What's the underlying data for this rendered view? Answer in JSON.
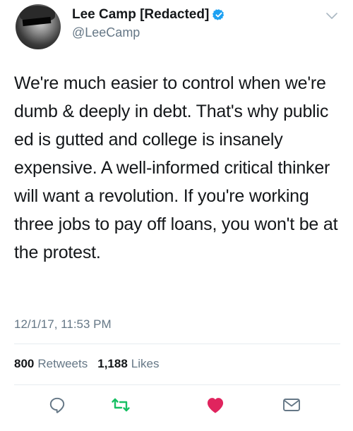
{
  "author": {
    "display_name": "Lee Camp [Redacted]",
    "handle": "@LeeCamp",
    "verified": true
  },
  "tweet": {
    "text": "We're much easier to control when we're dumb & deeply in debt. That's why public ed is gutted and college is insanely expensive. A well-informed critical thinker will want a revolution. If you're working three jobs to pay off loans, you won't be at the protest.",
    "timestamp": "12/1/17, 11:53 PM"
  },
  "stats": {
    "retweets_count": "800",
    "retweets_label": "Retweets",
    "likes_count": "1,188",
    "likes_label": "Likes"
  },
  "icons": {
    "reply": "reply-icon",
    "retweet": "retweet-icon",
    "like": "heart-icon",
    "message": "envelope-icon",
    "menu": "chevron-down-icon",
    "verified": "verified-badge-icon"
  },
  "colors": {
    "verified": "#1da1f2",
    "retweet": "#17bf63",
    "like": "#e0245e",
    "secondary_text": "#657786",
    "action_gray": "#657786"
  }
}
